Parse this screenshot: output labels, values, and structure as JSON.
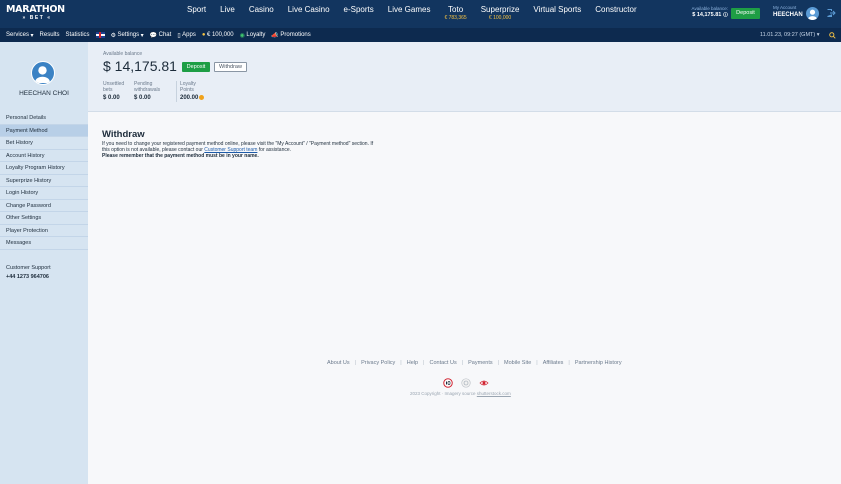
{
  "brand": {
    "line1": "MARATHON",
    "line2": "BET"
  },
  "nav": [
    {
      "label": "Sport",
      "jackpot": ""
    },
    {
      "label": "Live",
      "jackpot": ""
    },
    {
      "label": "Casino",
      "jackpot": ""
    },
    {
      "label": "Live Casino",
      "jackpot": ""
    },
    {
      "label": "e-Sports",
      "jackpot": ""
    },
    {
      "label": "Live Games",
      "jackpot": ""
    },
    {
      "label": "Toto",
      "jackpot": "€ 783,365"
    },
    {
      "label": "Superprize",
      "jackpot": "€ 100,000"
    },
    {
      "label": "Virtual Sports",
      "jackpot": ""
    },
    {
      "label": "Constructor",
      "jackpot": ""
    }
  ],
  "header": {
    "available_label": "Available balance:",
    "available_amount": "$ 14,175.81",
    "deposit_label": "Deposit",
    "account_label": "My Account",
    "account_name": "HEECHAN"
  },
  "subnav": {
    "services": "Services",
    "results": "Results",
    "statistics": "Statistics",
    "settings": "Settings",
    "chat": "Chat",
    "apps": "Apps",
    "jackpot": "€ 100,000",
    "loyalty": "Loyalty",
    "promotions": "Promotions",
    "datetime": "11.01.23, 09:27 (GMT)"
  },
  "profile": {
    "name": "HEECHAN CHOI"
  },
  "sidebar": {
    "items": [
      "Personal Details",
      "Payment Method",
      "Bet History",
      "Account History",
      "Loyalty Program History",
      "Superprize History",
      "Login History",
      "Change Password",
      "Other Settings",
      "Player Protection",
      "Messages"
    ],
    "active_index": 1,
    "support_label": "Customer Support",
    "support_phone": "+44 1273 964706"
  },
  "balance": {
    "label": "Available balance",
    "amount": "$ 14,175.81",
    "deposit": "Deposit",
    "withdraw": "Withdraw",
    "unsettled_label": "Unsettled bets",
    "unsettled_value": "$ 0.00",
    "pending_label": "Pending withdrawals",
    "pending_value": "$ 0.00",
    "loyalty_label": "Loyalty Points",
    "loyalty_value": "200.00"
  },
  "withdraw": {
    "title": "Withdraw",
    "text1": "If you need to change your registered payment method online, please visit the \"My Account\" / \"Payment method\" section. If this option is not available, please contact our ",
    "link": "Customer Support team",
    "text2": " for assistance.",
    "bold": "Please remember that the payment method must be in your name."
  },
  "footer": {
    "links": [
      "About Us",
      "Privacy Policy",
      "Help",
      "Contact Us",
      "Payments",
      "Mobile Site",
      "Affiliates",
      "Partnership History"
    ],
    "copyright_prefix": "2023 Copyright · Imagery source ",
    "copyright_link": "shutterstock.com"
  },
  "colors": {
    "topbar": "#12355f",
    "subbar": "#0d2a4f",
    "accent_green": "#1e9e45",
    "sidebar": "#d6e4f1",
    "jackpot": "#f5c242"
  }
}
